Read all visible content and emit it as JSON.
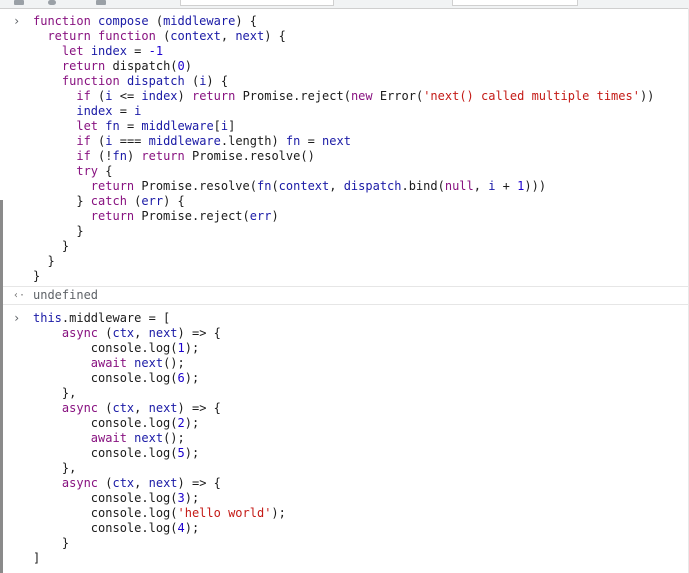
{
  "entries": [
    {
      "kind": "input",
      "lines": [
        [
          [
            "k",
            "function"
          ],
          [
            "t",
            " "
          ],
          [
            "f",
            "compose"
          ],
          [
            "t",
            " ("
          ],
          [
            "f",
            "middleware"
          ],
          [
            "t",
            ") {"
          ]
        ],
        [
          [
            "t",
            "  "
          ],
          [
            "k",
            "return"
          ],
          [
            "t",
            " "
          ],
          [
            "k",
            "function"
          ],
          [
            "t",
            " ("
          ],
          [
            "f",
            "context"
          ],
          [
            "t",
            ", "
          ],
          [
            "f",
            "next"
          ],
          [
            "t",
            ") {"
          ]
        ],
        [
          [
            "t",
            "    "
          ],
          [
            "k",
            "let"
          ],
          [
            "t",
            " "
          ],
          [
            "f",
            "index"
          ],
          [
            "t",
            " = "
          ],
          [
            "n",
            "-1"
          ]
        ],
        [
          [
            "t",
            "    "
          ],
          [
            "k",
            "return"
          ],
          [
            "t",
            " dispatch("
          ],
          [
            "n",
            "0"
          ],
          [
            "t",
            ")"
          ]
        ],
        [
          [
            "t",
            "    "
          ],
          [
            "k",
            "function"
          ],
          [
            "t",
            " "
          ],
          [
            "f",
            "dispatch"
          ],
          [
            "t",
            " ("
          ],
          [
            "f",
            "i"
          ],
          [
            "t",
            ") {"
          ]
        ],
        [
          [
            "t",
            "      "
          ],
          [
            "k",
            "if"
          ],
          [
            "t",
            " ("
          ],
          [
            "f",
            "i"
          ],
          [
            "t",
            " <= "
          ],
          [
            "f",
            "index"
          ],
          [
            "t",
            ") "
          ],
          [
            "k",
            "return"
          ],
          [
            "t",
            " Promise.reject("
          ],
          [
            "k",
            "new"
          ],
          [
            "t",
            " Error("
          ],
          [
            "s",
            "'next() called multiple times'"
          ],
          [
            "t",
            "))"
          ]
        ],
        [
          [
            "t",
            "      "
          ],
          [
            "f",
            "index"
          ],
          [
            "t",
            " = "
          ],
          [
            "f",
            "i"
          ]
        ],
        [
          [
            "t",
            "      "
          ],
          [
            "k",
            "let"
          ],
          [
            "t",
            " "
          ],
          [
            "f",
            "fn"
          ],
          [
            "t",
            " = "
          ],
          [
            "f",
            "middleware"
          ],
          [
            "t",
            "["
          ],
          [
            "f",
            "i"
          ],
          [
            "t",
            "]"
          ]
        ],
        [
          [
            "t",
            "      "
          ],
          [
            "k",
            "if"
          ],
          [
            "t",
            " ("
          ],
          [
            "f",
            "i"
          ],
          [
            "t",
            " === "
          ],
          [
            "f",
            "middleware"
          ],
          [
            "t",
            ".length) "
          ],
          [
            "f",
            "fn"
          ],
          [
            "t",
            " = "
          ],
          [
            "f",
            "next"
          ]
        ],
        [
          [
            "t",
            "      "
          ],
          [
            "k",
            "if"
          ],
          [
            "t",
            " (!"
          ],
          [
            "f",
            "fn"
          ],
          [
            "t",
            ") "
          ],
          [
            "k",
            "return"
          ],
          [
            "t",
            " Promise.resolve()"
          ]
        ],
        [
          [
            "t",
            "      "
          ],
          [
            "k",
            "try"
          ],
          [
            "t",
            " {"
          ]
        ],
        [
          [
            "t",
            "        "
          ],
          [
            "k",
            "return"
          ],
          [
            "t",
            " Promise.resolve("
          ],
          [
            "f",
            "fn"
          ],
          [
            "t",
            "("
          ],
          [
            "f",
            "context"
          ],
          [
            "t",
            ", "
          ],
          [
            "f",
            "dispatch"
          ],
          [
            "t",
            ".bind("
          ],
          [
            "k",
            "null"
          ],
          [
            "t",
            ", "
          ],
          [
            "f",
            "i"
          ],
          [
            "t",
            " + "
          ],
          [
            "n",
            "1"
          ],
          [
            "t",
            ")))"
          ]
        ],
        [
          [
            "t",
            "      } "
          ],
          [
            "k",
            "catch"
          ],
          [
            "t",
            " ("
          ],
          [
            "f",
            "err"
          ],
          [
            "t",
            ") {"
          ]
        ],
        [
          [
            "t",
            "        "
          ],
          [
            "k",
            "return"
          ],
          [
            "t",
            " Promise.reject("
          ],
          [
            "f",
            "err"
          ],
          [
            "t",
            ")"
          ]
        ],
        [
          [
            "t",
            "      }"
          ]
        ],
        [
          [
            "t",
            "    }"
          ]
        ],
        [
          [
            "t",
            "  }"
          ]
        ],
        [
          [
            "t",
            "}"
          ]
        ]
      ]
    },
    {
      "kind": "result",
      "text": "undefined"
    },
    {
      "kind": "input",
      "lines": [
        [
          [
            "f",
            "this"
          ],
          [
            "t",
            ".middleware = ["
          ]
        ],
        [
          [
            "t",
            "    "
          ],
          [
            "k",
            "async"
          ],
          [
            "t",
            " ("
          ],
          [
            "f",
            "ctx"
          ],
          [
            "t",
            ", "
          ],
          [
            "f",
            "next"
          ],
          [
            "t",
            ") => {"
          ]
        ],
        [
          [
            "t",
            "        console.log("
          ],
          [
            "n",
            "1"
          ],
          [
            "t",
            ");"
          ]
        ],
        [
          [
            "t",
            "        "
          ],
          [
            "k",
            "await"
          ],
          [
            "t",
            " "
          ],
          [
            "f",
            "next"
          ],
          [
            "t",
            "();"
          ]
        ],
        [
          [
            "t",
            "        console.log("
          ],
          [
            "n",
            "6"
          ],
          [
            "t",
            ");"
          ]
        ],
        [
          [
            "t",
            "    },"
          ]
        ],
        [
          [
            "t",
            "    "
          ],
          [
            "k",
            "async"
          ],
          [
            "t",
            " ("
          ],
          [
            "f",
            "ctx"
          ],
          [
            "t",
            ", "
          ],
          [
            "f",
            "next"
          ],
          [
            "t",
            ") => {"
          ]
        ],
        [
          [
            "t",
            "        console.log("
          ],
          [
            "n",
            "2"
          ],
          [
            "t",
            ");"
          ]
        ],
        [
          [
            "t",
            "        "
          ],
          [
            "k",
            "await"
          ],
          [
            "t",
            " "
          ],
          [
            "f",
            "next"
          ],
          [
            "t",
            "();"
          ]
        ],
        [
          [
            "t",
            "        console.log("
          ],
          [
            "n",
            "5"
          ],
          [
            "t",
            ");"
          ]
        ],
        [
          [
            "t",
            "    },"
          ]
        ],
        [
          [
            "t",
            "    "
          ],
          [
            "k",
            "async"
          ],
          [
            "t",
            " ("
          ],
          [
            "f",
            "ctx"
          ],
          [
            "t",
            ", "
          ],
          [
            "f",
            "next"
          ],
          [
            "t",
            ") => {"
          ]
        ],
        [
          [
            "t",
            "        console.log("
          ],
          [
            "n",
            "3"
          ],
          [
            "t",
            ");"
          ]
        ],
        [
          [
            "t",
            "        console.log("
          ],
          [
            "s",
            "'hello world'"
          ],
          [
            "t",
            ");"
          ]
        ],
        [
          [
            "t",
            "        console.log("
          ],
          [
            "n",
            "4"
          ],
          [
            "t",
            ");"
          ]
        ],
        [
          [
            "t",
            "    }"
          ]
        ],
        [
          [
            "t",
            "]"
          ]
        ]
      ]
    }
  ],
  "prompt_glyph": "›",
  "result_glyph": "‹·",
  "icons": {
    "input_prompt": "chevron-right-icon",
    "result_marker": "chevron-left-icon"
  },
  "colors": {
    "keyword": "#881280",
    "identifier": "#1a1aa6",
    "string": "#c41a16",
    "number": "#1c00cf",
    "text": "#1a1a1a",
    "muted": "#5f6368"
  }
}
